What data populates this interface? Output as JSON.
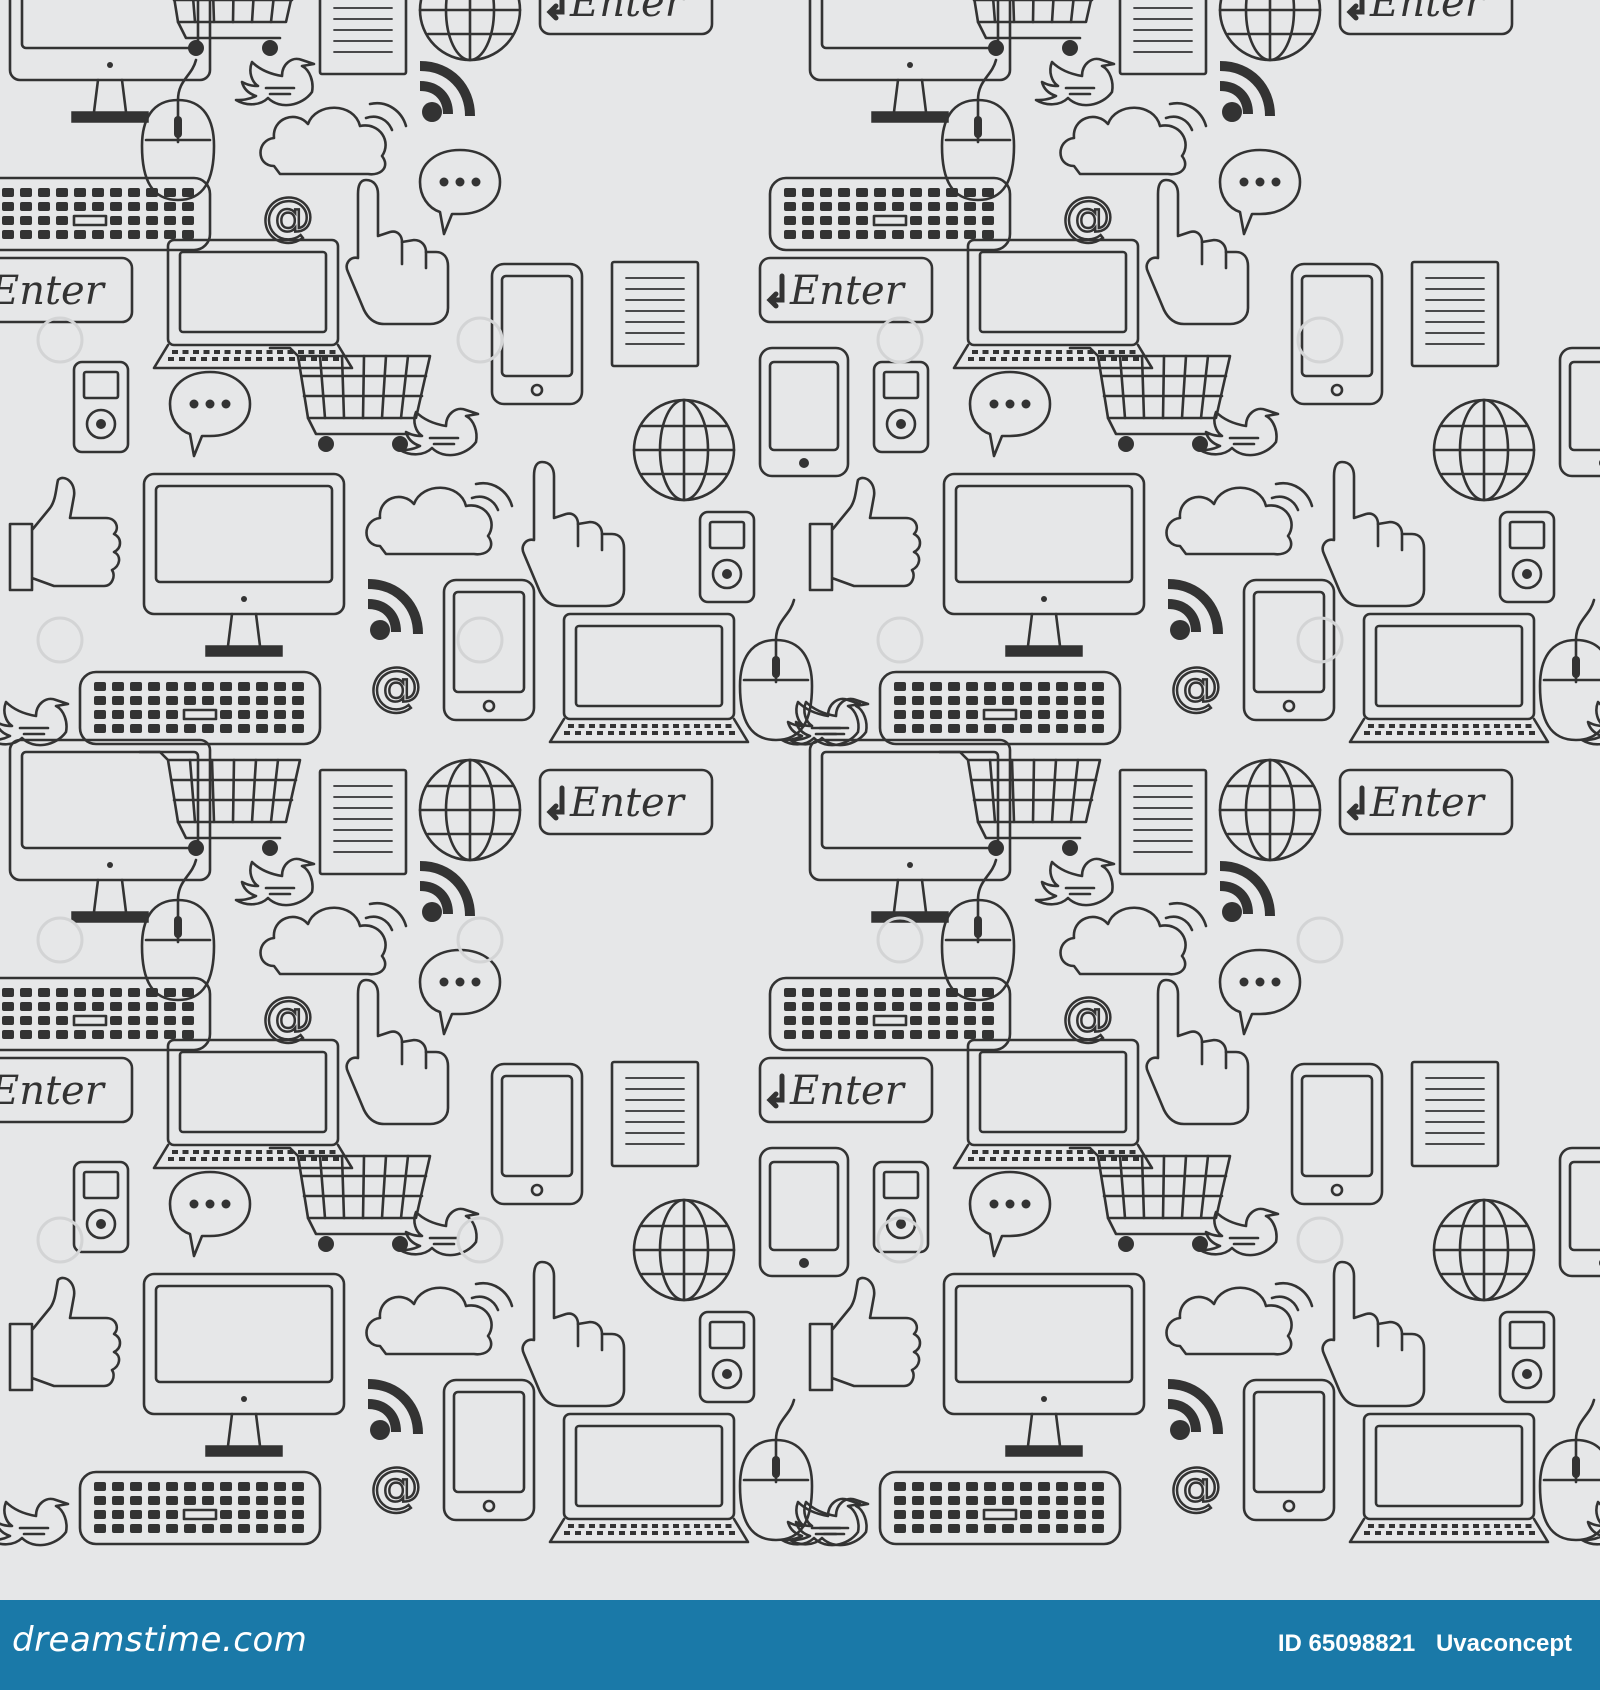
{
  "pattern": {
    "background_color": "#e6e7e8",
    "ink_color": "#333333",
    "enter_key_label": "Enter",
    "at_sign": "@",
    "icons": [
      "monitor-icon",
      "keyboard-icon",
      "laptop-icon",
      "tablet-icon",
      "phone-icon",
      "mouse-icon",
      "cursor-hand-icon",
      "thumbs-up-icon",
      "cart-icon",
      "globe-icon",
      "cloud-icon",
      "rss-icon",
      "chat-bubble-icon",
      "bird-icon",
      "document-icon",
      "media-player-icon",
      "enter-key-icon",
      "at-sign-icon"
    ]
  },
  "footer": {
    "background_color": "#1a79a8",
    "logo_text": "dreamstime.com",
    "id_text": "ID 65098821",
    "author_text": "Uvaconcept"
  }
}
